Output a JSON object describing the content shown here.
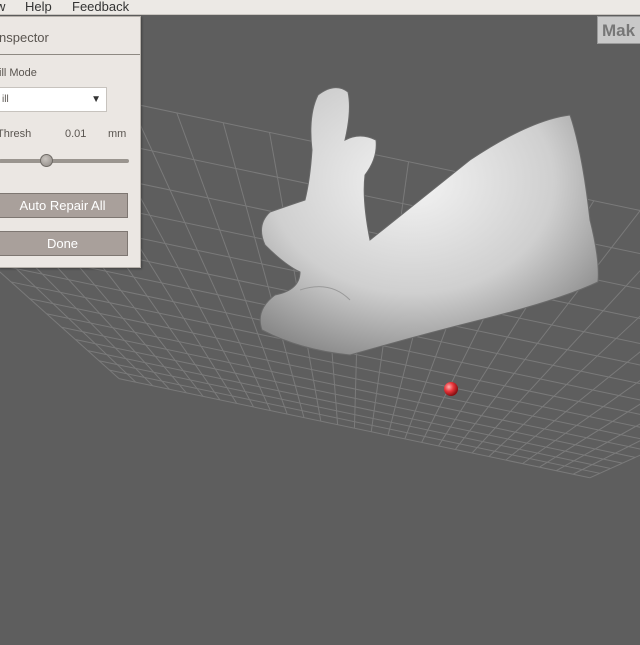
{
  "menubar": {
    "items": [
      "w",
      "Help",
      "Feedback"
    ]
  },
  "inspector": {
    "title": "nspector",
    "fill_mode_label": "ill Mode",
    "fill_mode_value": "ill",
    "thresh_label": "Thresh",
    "thresh_value": "0.01",
    "thresh_unit": "mm",
    "thresh_slider_fraction": 0.35,
    "auto_repair_label": "Auto Repair All",
    "done_label": "Done"
  },
  "make_button": {
    "label": "Mak"
  },
  "colors": {
    "viewport": "#5e5e5e",
    "panel": "#ebe7e3",
    "button": "#a9a09b",
    "marker": "#e8353a",
    "mesh": "#d8d8d8"
  },
  "icons": {
    "dropdown": "triangle-down-icon"
  }
}
